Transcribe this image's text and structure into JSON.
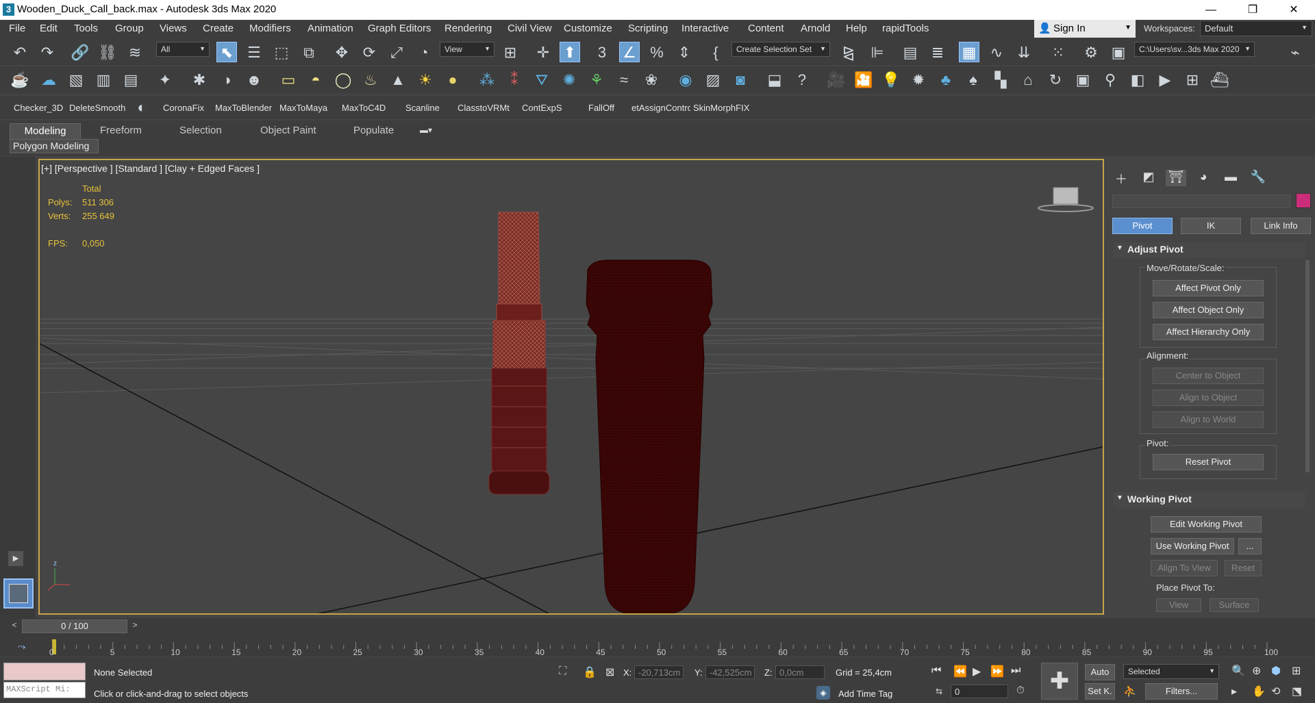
{
  "titlebar": {
    "title": "Wooden_Duck_Call_back.max - Autodesk 3ds Max 2020",
    "logo": "3"
  },
  "menu": {
    "items": [
      "File",
      "Edit",
      "Tools",
      "Group",
      "Views",
      "Create",
      "Modifiers",
      "Animation",
      "Graph Editors",
      "Rendering",
      "Civil View",
      "Customize",
      "Scripting",
      "Interactive",
      "Content",
      "Arnold",
      "Help",
      "rapidTools"
    ],
    "sign_in": "Sign In",
    "workspaces_label": "Workspaces:",
    "workspace": "Default"
  },
  "toolbar": {
    "filter": "All",
    "ref_coord": "View",
    "selection_set": "Create Selection Set",
    "project_path": "C:\\Users\\sv...3ds Max 2020"
  },
  "plugins": {
    "items": [
      "Checker_3D",
      "DeleteSmooth",
      "CoronaFix",
      "MaxToBlender",
      "MaxToMaya",
      "MaxToC4D",
      "Scanline",
      "ClasstoVRMt",
      "ContExpS",
      "FallOff",
      "etAssignContrc",
      "SkinMorphFIX"
    ]
  },
  "ribbon": {
    "tabs": [
      "Modeling",
      "Freeform",
      "Selection",
      "Object Paint",
      "Populate"
    ],
    "panel": "Polygon Modeling"
  },
  "viewport": {
    "label": "[+] [Perspective ] [Standard ] [Clay + Edged Faces ]",
    "total_label": "Total",
    "polys_label": "Polys:",
    "polys": "511 306",
    "verts_label": "Verts:",
    "verts": "255 649",
    "fps_label": "FPS:",
    "fps": "0,050"
  },
  "command_panel": {
    "tabs": [
      "create-icon",
      "modify-icon",
      "hierarchy-icon",
      "motion-icon",
      "display-icon",
      "utilities-icon"
    ],
    "color_swatch": "#cc2d7a",
    "subtabs": [
      "Pivot",
      "IK",
      "Link Info"
    ],
    "adjust_pivot": {
      "title": "Adjust Pivot",
      "group": "Move/Rotate/Scale:",
      "buttons": [
        "Affect Pivot Only",
        "Affect Object Only",
        "Affect Hierarchy Only"
      ]
    },
    "alignment": {
      "title": "Alignment:",
      "buttons": [
        "Center to Object",
        "Align to Object",
        "Align to World"
      ]
    },
    "pivot": {
      "title": "Pivot:",
      "button": "Reset Pivot"
    },
    "working_pivot": {
      "title": "Working Pivot",
      "edit": "Edit Working Pivot",
      "use": "Use Working Pivot",
      "more": "...",
      "align_view": "Align To View",
      "reset": "Reset",
      "place_label": "Place Pivot To:",
      "view": "View",
      "surface": "Surface"
    }
  },
  "timeline": {
    "slider": "0 / 100",
    "ticks": [
      "0",
      "5",
      "10",
      "15",
      "20",
      "25",
      "30",
      "35",
      "40",
      "45",
      "50",
      "55",
      "60",
      "65",
      "70",
      "75",
      "80",
      "85",
      "90",
      "95",
      "100"
    ]
  },
  "status": {
    "maxscript": "MAXScript Mi:",
    "selection": "None Selected",
    "prompt": "Click or click-and-drag to select objects",
    "x_label": "X:",
    "x": "-20,713cm",
    "y_label": "Y:",
    "y": "-42,525cm",
    "z_label": "Z:",
    "z": "0,0cm",
    "grid": "Grid = 25,4cm",
    "add_time_tag": "Add Time Tag",
    "auto": "Auto",
    "set_k": "Set K.",
    "selected": "Selected",
    "filters": "Filters...",
    "frame": "0"
  }
}
